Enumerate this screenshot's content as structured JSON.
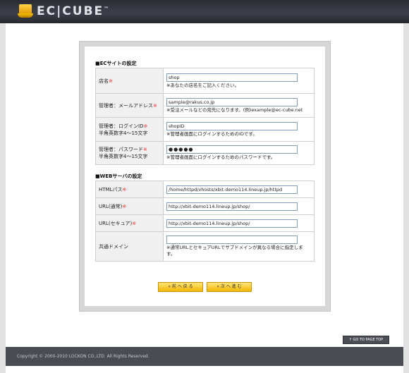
{
  "header": {
    "logo_text": "EC|CUBE",
    "tm": "™"
  },
  "section1": {
    "title": "■ECサイトの設定",
    "rows": [
      {
        "label": "店名",
        "req": "※",
        "value": "shop",
        "note": "※あなたの店名をご記入ください。"
      },
      {
        "label": "管理者：メールアドレス",
        "req": "※",
        "value": "sample@rakus.co.jp",
        "note": "※受注メールなどの宛先になります。(例)example@ec-cube.net"
      },
      {
        "label": "管理者：ログインID",
        "req": "※",
        "sublabel": "半角英数字4～15文字",
        "value": "shopID",
        "note": "※管理者画面にログインするためのIDです。"
      },
      {
        "label": "管理者：パスワード",
        "req": "※",
        "sublabel": "半角英数字4～15文字",
        "value": "●●●●●",
        "note": "※管理者画面にログインするためのパスワードです。"
      }
    ]
  },
  "section2": {
    "title": "■WEBサーバの設定",
    "rows": [
      {
        "label": "HTMLパス",
        "req": "※",
        "value": "/home/httpd/vhosts/xbit-demo114.lineup.jp/httpd"
      },
      {
        "label": "URL(通常)",
        "req": "※",
        "value": "http://xbit-demo114.lineup.jp/shop/"
      },
      {
        "label": "URL(セキュア)",
        "req": "※",
        "value": "http://xbit-demo114.lineup.jp/shop/"
      },
      {
        "label": "共通ドメイン",
        "req": "",
        "value": "",
        "note": "※通常URLとセキュアURLでサブドメインが異なる場合に指定します。"
      }
    ]
  },
  "buttons": {
    "back": "« 前 へ 戻 る",
    "next": "» 次 へ 進 む"
  },
  "totop": "↑ GO TO PAGE TOP",
  "footer": "Copyright © 2000-2010 LOCKON CO.,LTD. All Rights Reserved."
}
